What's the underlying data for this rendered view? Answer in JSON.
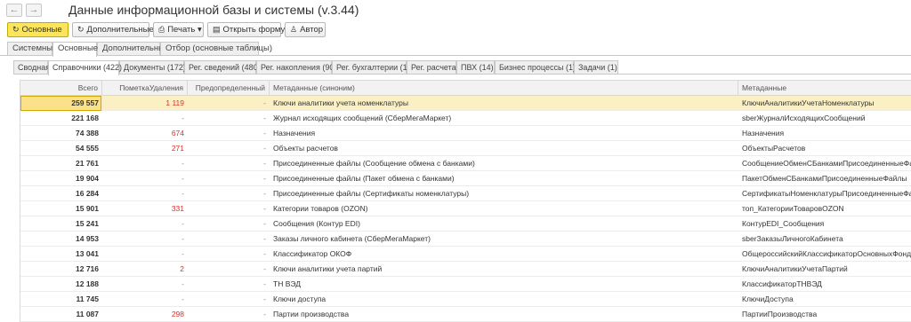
{
  "nav": {
    "back": "←",
    "forward": "→"
  },
  "title": "Данные информационной базы и системы (v.3.44)",
  "toolbar": [
    {
      "label": "Основные",
      "icon": "↻",
      "icon_name": "refresh-icon"
    },
    {
      "label": "Дополнительные",
      "icon": "↻",
      "icon_name": "refresh-icon"
    },
    {
      "label": "Печать ▾",
      "icon": "⎙",
      "icon_name": "printer-icon"
    },
    {
      "label": "Открыть форму ▾",
      "icon": "▤",
      "icon_name": "form-icon"
    },
    {
      "label": "Автор",
      "icon": "♙",
      "icon_name": "user-icon"
    }
  ],
  "tabs_main": [
    "Системные",
    "Основные",
    "Дополнительные",
    "Отбор (основные таблицы)"
  ],
  "tabs_main_active": 1,
  "tabs_sub": [
    "Сводная",
    "Справочники (422)",
    "Документы (172)",
    "Рег. сведений (480)",
    "Рег. накопления (90)",
    "Рег. бухгалтерии (1)",
    "Рег. расчета",
    "ПВХ (14)",
    "Бизнес процессы (1)",
    "Задачи (1)"
  ],
  "tabs_sub_active": 1,
  "columns": [
    "Всего",
    "ПометкаУдаления",
    "Предопределенный",
    "Метаданные (синоним)",
    "Метаданные"
  ],
  "colors": {
    "accent": "#fbe55c",
    "selected_row": "#fbf0c3",
    "mark": "#d9312b"
  },
  "rows": [
    {
      "total": "259 557",
      "mark": "1 119",
      "predef": "-",
      "synonym": "Ключи аналитики учета номенклатуры",
      "meta": "КлючиАналитикиУчетаНоменклатуры",
      "selected": true
    },
    {
      "total": "221 168",
      "mark": "-",
      "predef": "-",
      "synonym": "Журнал исходящих сообщений (СберМегаМаркет)",
      "meta": "sberЖурналИсходящихСообщений"
    },
    {
      "total": "74 388",
      "mark": "674",
      "predef": "-",
      "synonym": "Назначения",
      "meta": "Назначения"
    },
    {
      "total": "54 555",
      "mark": "271",
      "predef": "-",
      "synonym": "Объекты расчетов",
      "meta": "ОбъектыРасчетов"
    },
    {
      "total": "21 761",
      "mark": "-",
      "predef": "-",
      "synonym": "Присоединенные файлы (Сообщение обмена с банками)",
      "meta": "СообщениеОбменСБанкамиПрисоединенныеФайлы"
    },
    {
      "total": "19 904",
      "mark": "-",
      "predef": "-",
      "synonym": "Присоединенные файлы (Пакет обмена с банками)",
      "meta": "ПакетОбменСБанкамиПрисоединенныеФайлы"
    },
    {
      "total": "16 284",
      "mark": "-",
      "predef": "-",
      "synonym": "Присоединенные файлы (Сертификаты номенклатуры)",
      "meta": "СертификатыНоменклатурыПрисоединенныеФайлы"
    },
    {
      "total": "15 901",
      "mark": "331",
      "predef": "-",
      "synonym": "Категории товаров (OZON)",
      "meta": "топ_КатегорииТоваровOZON"
    },
    {
      "total": "15 241",
      "mark": "-",
      "predef": "-",
      "synonym": "Сообщения (Контур EDI)",
      "meta": "КонтурEDI_Сообщения"
    },
    {
      "total": "14 953",
      "mark": "-",
      "predef": "-",
      "synonym": "Заказы личного кабинета (СберМегаМаркет)",
      "meta": "sberЗаказыЛичногоКабинета"
    },
    {
      "total": "13 041",
      "mark": "-",
      "predef": "-",
      "synonym": "Классификатор ОКОФ",
      "meta": "ОбщероссийскийКлассификаторОсновныхФондов"
    },
    {
      "total": "12 716",
      "mark": "2",
      "predef": "-",
      "synonym": "Ключи аналитики учета партий",
      "meta": "КлючиАналитикиУчетаПартий"
    },
    {
      "total": "12 188",
      "mark": "-",
      "predef": "-",
      "synonym": "ТН ВЭД",
      "meta": "КлассификаторТНВЭД"
    },
    {
      "total": "11 745",
      "mark": "-",
      "predef": "-",
      "synonym": "Ключи доступа",
      "meta": "КлючиДоступа"
    },
    {
      "total": "11 087",
      "mark": "298",
      "predef": "-",
      "synonym": "Партии производства",
      "meta": "ПартииПроизводства"
    }
  ]
}
